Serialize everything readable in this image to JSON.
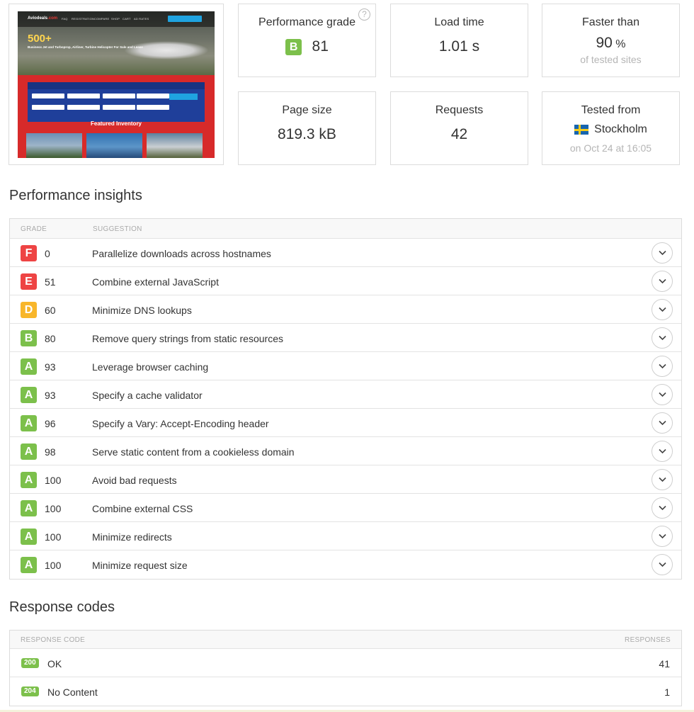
{
  "colors": {
    "grade_A": "#7cc04b",
    "grade_B": "#7cc04b",
    "grade_D": "#f8b62a",
    "grade_E": "#ee4444",
    "grade_F": "#ee4444",
    "border": "#dcdcdc"
  },
  "screenshot_preview": {
    "site_logo_main": "Aviodeals",
    "site_logo_accent": ".com",
    "nav_items": [
      "FAQ",
      "REGISTRATION",
      "COMPARE",
      "SHOP",
      "CART",
      "AD RATES"
    ],
    "hero_headline": "500+",
    "hero_subline": "Business Jet and Turboprop, Airliner, Turbine Helicopter For Sale and Lease",
    "featured_heading": "Featured Inventory"
  },
  "summary": {
    "performance_grade": {
      "label": "Performance grade",
      "grade": "B",
      "score": "81",
      "help_icon": "question-circle-icon"
    },
    "load_time": {
      "label": "Load time",
      "value": "1.01 s"
    },
    "faster_than": {
      "label": "Faster than",
      "value": "90",
      "unit": "%",
      "note": "of tested sites"
    },
    "page_size": {
      "label": "Page size",
      "value": "819.3 kB"
    },
    "requests": {
      "label": "Requests",
      "value": "42"
    },
    "tested_from": {
      "label": "Tested from",
      "location": "Stockholm",
      "flag_icon": "sweden-flag-icon",
      "when": "on Oct 24 at 16:05"
    }
  },
  "insights": {
    "title": "Performance insights",
    "headers": {
      "grade": "GRADE",
      "suggestion": "SUGGESTION"
    },
    "rows": [
      {
        "grade": "F",
        "score": "0",
        "suggestion": "Parallelize downloads across hostnames"
      },
      {
        "grade": "E",
        "score": "51",
        "suggestion": "Combine external JavaScript"
      },
      {
        "grade": "D",
        "score": "60",
        "suggestion": "Minimize DNS lookups"
      },
      {
        "grade": "B",
        "score": "80",
        "suggestion": "Remove query strings from static resources"
      },
      {
        "grade": "A",
        "score": "93",
        "suggestion": "Leverage browser caching"
      },
      {
        "grade": "A",
        "score": "93",
        "suggestion": "Specify a cache validator"
      },
      {
        "grade": "A",
        "score": "96",
        "suggestion": "Specify a Vary: Accept-Encoding header"
      },
      {
        "grade": "A",
        "score": "98",
        "suggestion": "Serve static content from a cookieless domain"
      },
      {
        "grade": "A",
        "score": "100",
        "suggestion": "Avoid bad requests"
      },
      {
        "grade": "A",
        "score": "100",
        "suggestion": "Combine external CSS"
      },
      {
        "grade": "A",
        "score": "100",
        "suggestion": "Minimize redirects"
      },
      {
        "grade": "A",
        "score": "100",
        "suggestion": "Minimize request size"
      }
    ]
  },
  "response_codes": {
    "title": "Response codes",
    "headers": {
      "code": "RESPONSE CODE",
      "responses": "RESPONSES"
    },
    "rows": [
      {
        "code": "200",
        "text": "OK",
        "count": "41"
      },
      {
        "code": "204",
        "text": "No Content",
        "count": "1"
      }
    ]
  }
}
